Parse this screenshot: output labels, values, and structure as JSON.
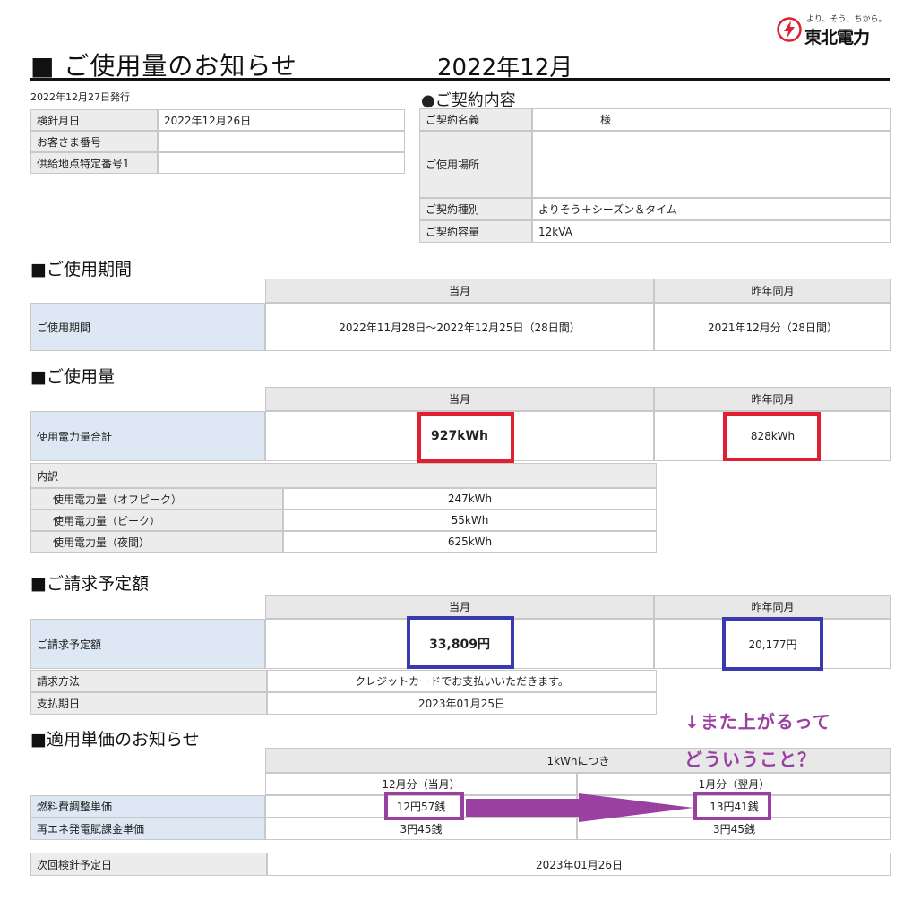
{
  "logo": {
    "tagline": "より、そう、ちから。",
    "name": "東北電力",
    "icon": "lightning-bolt-icon"
  },
  "title": {
    "heading": "■ ご使用量のお知らせ",
    "month": "2022年12月"
  },
  "issue_date": "2022年12月27日発行",
  "meter": {
    "rows": [
      {
        "label": "検針月日",
        "value": "2022年12月26日"
      },
      {
        "label": "お客さま番号",
        "value": ""
      },
      {
        "label": "供給地点特定番号1",
        "value": ""
      }
    ]
  },
  "contract": {
    "heading": "●ご契約内容",
    "name_label": "ご契約名義",
    "name_value": "様",
    "place_label": "ご使用場所",
    "place_value": "",
    "type_label": "ご契約種別",
    "type_value": "よりそう＋シーズン＆タイム",
    "capacity_label": "ご契約容量",
    "capacity_value": "12kVA"
  },
  "period": {
    "heading": "■ご使用期間",
    "col_current": "当月",
    "col_last_year": "昨年同月",
    "label": "ご使用期間",
    "current": "2022年11月28日～2022年12月25日（28日間）",
    "last_year": "2021年12月分（28日間）"
  },
  "usage": {
    "heading": "■ご使用量",
    "col_current": "当月",
    "col_last_year": "昨年同月",
    "total_label": "使用電力量合計",
    "total_current": "927kWh",
    "total_last_year": "828kWh",
    "breakdown_label": "内訳",
    "rows": [
      {
        "label": "使用電力量（オフピーク）",
        "value": "247kWh"
      },
      {
        "label": "使用電力量（ピーク）",
        "value": "55kWh"
      },
      {
        "label": "使用電力量（夜間）",
        "value": "625kWh"
      }
    ]
  },
  "billing": {
    "heading": "■ご請求予定額",
    "col_current": "当月",
    "col_last_year": "昨年同月",
    "amount_label": "ご請求予定額",
    "amount_current": "33,809円",
    "amount_last_year": "20,177円",
    "method_label": "請求方法",
    "method_value": "クレジットカードでお支払いいただきます。",
    "due_label": "支払期日",
    "due_value": "2023年01月25日"
  },
  "unit_price": {
    "heading": "■適用単価のお知らせ",
    "per_unit": "1kWhにつき",
    "col_current": "12月分（当月）",
    "col_next": "1月分（翌月）",
    "rows": [
      {
        "label": "燃料費調整単価",
        "current": "12円57銭",
        "next": "13円41銭"
      },
      {
        "label": "再エネ発電賦課金単価",
        "current": "3円45銭",
        "next": "3円45銭"
      }
    ]
  },
  "next_reading": {
    "label": "次回検針予定日",
    "value": "2023年01月26日"
  },
  "annotation": {
    "line1": "↓また上がるって",
    "line2": "どういうこと？"
  }
}
